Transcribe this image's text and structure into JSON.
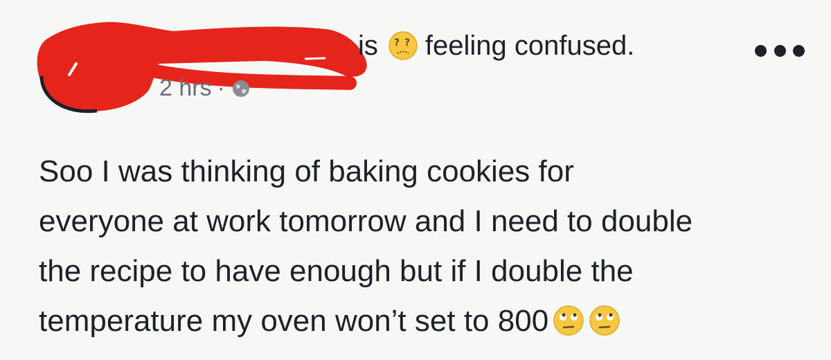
{
  "header": {
    "is_text": "is",
    "feeling_text": "feeling confused.",
    "feeling_icon": "confused-face-icon"
  },
  "meta": {
    "time": "2 hrs",
    "separator": "·",
    "audience_icon": "globe-icon"
  },
  "more_icon": "more-options-icon",
  "post": {
    "lines": [
      "Soo I was thinking of baking cookies for",
      "everyone at work tomorrow and I need to double",
      "the recipe to have enough but if I double the",
      "temperature my oven won’t set to 800"
    ],
    "trailing_emojis": [
      "rolling-eyes-face-icon",
      "rolling-eyes-face-icon"
    ]
  },
  "colors": {
    "redaction": "#e5251c",
    "text": "#1d2129",
    "meta": "#6a6e76",
    "emoji": "#f6c842"
  }
}
